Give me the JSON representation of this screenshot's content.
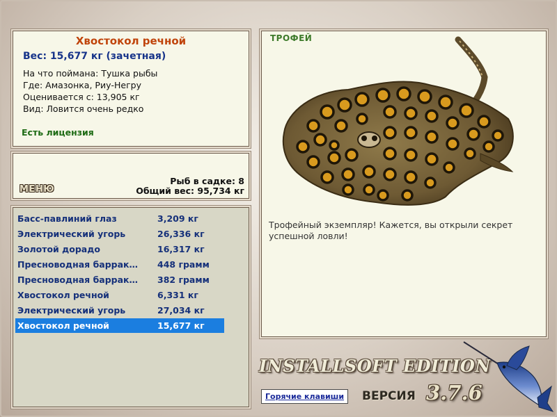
{
  "fish": {
    "name": "Хвостокол речной",
    "weight_line": "Вес: 15,677 кг (зачетная)",
    "details": [
      "На что поймана: Тушка рыбы",
      "Где: Амазонка, Риу-Негру",
      "Оценивается с: 13,905 кг",
      "Вид: Ловится очень редко"
    ],
    "license": "Есть лицензия"
  },
  "menu": {
    "label": "МЕНЮ",
    "fish_in_cage": "Рыб в садке: 8",
    "total_weight": "Общий вес: 95,734 кг"
  },
  "catch_list": [
    {
      "name": "Басс-павлиний глаз",
      "weight": "3,209 кг"
    },
    {
      "name": "Электрический угорь",
      "weight": "26,336 кг"
    },
    {
      "name": "Золотой дорадо",
      "weight": "16,317 кг"
    },
    {
      "name": "Пресноводная барракуда",
      "weight": "448 грамм"
    },
    {
      "name": "Пресноводная барракуда",
      "weight": "382 грамм"
    },
    {
      "name": "Хвостокол речной",
      "weight": "6,331 кг"
    },
    {
      "name": "Электрический угорь",
      "weight": "27,034 кг"
    },
    {
      "name": "Хвостокол речной",
      "weight": "15,677 кг",
      "selected": true
    }
  ],
  "trophy": {
    "label": "ТРОФЕЙ",
    "description": "Трофейный экземпляр! Кажется, вы открыли секрет успешной ловли!"
  },
  "branding": {
    "edition": "INSTALLSOFT EDITION",
    "version_word": "ВЕРСИЯ",
    "version_number": "3.7.6",
    "hotkeys": "Горячие клавиши"
  },
  "colors": {
    "title_orange": "#c0440b",
    "weight_blue": "#17348a",
    "license_green": "#1e6b14",
    "selection_blue": "#1b7ee0"
  },
  "icons": [
    "stingray-image",
    "marlin-image"
  ]
}
